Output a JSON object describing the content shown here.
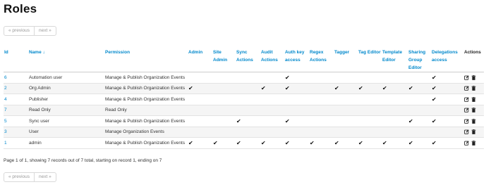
{
  "page_title": "Roles",
  "pagination": {
    "previous": "« previous",
    "next": "next »"
  },
  "columns": [
    {
      "key": "id",
      "label": "Id",
      "sortable": true
    },
    {
      "key": "name",
      "label": "Name ↓",
      "sortable": true
    },
    {
      "key": "permission",
      "label": "Permission",
      "sortable": true
    },
    {
      "key": "admin",
      "label": "Admin",
      "sortable": true
    },
    {
      "key": "site_admin",
      "label": "Site Admin",
      "sortable": true
    },
    {
      "key": "sync_actions",
      "label": "Sync Actions",
      "sortable": true
    },
    {
      "key": "audit_actions",
      "label": "Audit Actions",
      "sortable": true
    },
    {
      "key": "auth_key_access",
      "label": "Auth key access",
      "sortable": true
    },
    {
      "key": "regex_actions",
      "label": "Regex Actions",
      "sortable": true
    },
    {
      "key": "tagger",
      "label": "Tagger",
      "sortable": true
    },
    {
      "key": "tag_editor",
      "label": "Tag Editor",
      "sortable": true
    },
    {
      "key": "template_editor",
      "label": "Template Editor",
      "sortable": true
    },
    {
      "key": "sharing_group_editor",
      "label": "Sharing Group Editor",
      "sortable": true
    },
    {
      "key": "delegations_access",
      "label": "Delegations access",
      "sortable": true
    },
    {
      "key": "actions",
      "label": "Actions",
      "sortable": false
    }
  ],
  "check_glyph": "✔",
  "rows": [
    {
      "id": "6",
      "name": "Automation user",
      "permission": "Manage & Publish Organization Events",
      "flags": [
        false,
        false,
        false,
        false,
        true,
        false,
        false,
        false,
        false,
        false,
        true
      ]
    },
    {
      "id": "2",
      "name": "Org Admin",
      "permission": "Manage & Publish Organization Events",
      "flags": [
        true,
        false,
        false,
        true,
        true,
        false,
        true,
        true,
        true,
        true,
        true
      ]
    },
    {
      "id": "4",
      "name": "Publisher",
      "permission": "Manage & Publish Organization Events",
      "flags": [
        false,
        false,
        false,
        false,
        false,
        false,
        false,
        false,
        false,
        false,
        true
      ]
    },
    {
      "id": "7",
      "name": "Read Only",
      "permission": "Read Only",
      "flags": [
        false,
        false,
        false,
        false,
        false,
        false,
        false,
        false,
        false,
        false,
        false
      ]
    },
    {
      "id": "5",
      "name": "Sync user",
      "permission": "Manage & Publish Organization Events",
      "flags": [
        false,
        false,
        true,
        false,
        true,
        false,
        false,
        false,
        false,
        true,
        true
      ]
    },
    {
      "id": "3",
      "name": "User",
      "permission": "Manage Organization Events",
      "flags": [
        false,
        false,
        false,
        false,
        false,
        false,
        false,
        false,
        false,
        false,
        false
      ]
    },
    {
      "id": "1",
      "name": "admin",
      "permission": "Manage & Publish Organization Events",
      "flags": [
        true,
        true,
        true,
        true,
        true,
        true,
        true,
        true,
        true,
        true,
        true
      ]
    }
  ],
  "summary": "Page 1 of 1, showing 7 records out of 7 total, starting on record 1, ending on 7",
  "icons": {
    "edit": "edit-icon",
    "delete": "trash-icon"
  }
}
